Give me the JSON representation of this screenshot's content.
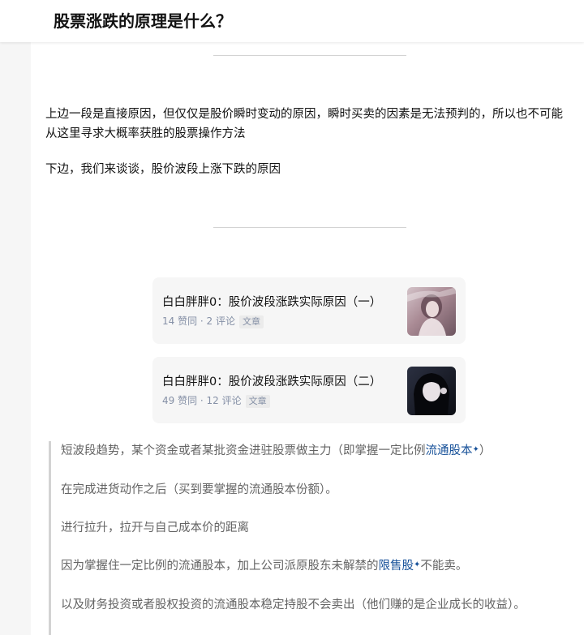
{
  "header": {
    "title": "股票涨跌的原理是什么？"
  },
  "article": {
    "paragraphs": [
      "上边一段是直接原因，但仅仅是股价瞬时变动的原因，瞬时买卖的因素是无法预判的，所以也不可能从这里寻求大概率获胜的股票操作方法",
      "下边，我们来谈谈，股价波段上涨下跌的原因"
    ],
    "cards": [
      {
        "title": "白白胖胖0：股价波段涨跌实际原因（一）",
        "likes": "14 赞同",
        "comments": "2 评论",
        "tag": "文章",
        "sep": " · "
      },
      {
        "title": "白白胖胖0：股价波段涨跌实际原因（二）",
        "likes": "49 赞同",
        "comments": "12 评论",
        "tag": "文章",
        "sep": " · "
      }
    ],
    "quote": {
      "line1_before": "短波段趋势，某个资金或者某批资金进驻股票做主力（即掌握一定比例",
      "line1_link": "流通股本",
      "line1_after": "）",
      "line2": "在完成进货动作之后（买到要掌握的流通股本份额）。",
      "line3": "进行拉升，拉开与自己成本价的距离",
      "line4_before": "因为掌握住一定比例的流通股本，加上公司派原股东未解禁的",
      "line4_link": "限售股",
      "line4_after": "不能卖。",
      "line5": "以及财务投资或者股权投资的流通股本稳定持股不会卖出（他们赚的是企业成长的收益）。"
    }
  },
  "icons": {
    "link_spark": "sparkle-icon"
  },
  "colors": {
    "link": "#175199",
    "meta": "#8590a6",
    "quote_text": "#646464",
    "card_bg": "#f6f6f6"
  }
}
